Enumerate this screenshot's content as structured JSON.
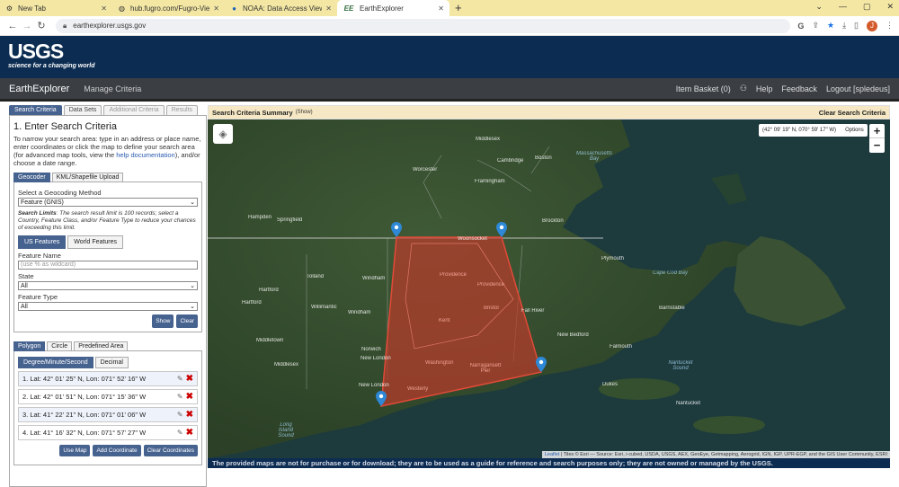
{
  "browser": {
    "tabs": [
      {
        "title": "New Tab",
        "icon": "new-tab-icon"
      },
      {
        "title": "hub.fugro.com/Fugro-Viewer/",
        "icon": "globe-icon"
      },
      {
        "title": "NOAA: Data Access Viewer",
        "icon": "noaa-icon"
      },
      {
        "title": "EarthExplorer",
        "icon": "ee-icon",
        "favicon_text": "EE",
        "active": true
      }
    ],
    "url": "earthexplorer.usgs.gov",
    "profile_initial": "J"
  },
  "usgs": {
    "logo": "USGS",
    "tagline": "science for a changing world"
  },
  "appnav": {
    "brand": "EarthExplorer",
    "manage": "Manage Criteria",
    "item_basket": "Item Basket (0)",
    "help": "Help",
    "feedback": "Feedback",
    "logout": "Logout [spledeus]"
  },
  "left": {
    "tabs": [
      "Search Criteria",
      "Data Sets",
      "Additional Criteria",
      "Results"
    ],
    "heading": "1. Enter Search Criteria",
    "desc_pre": "To narrow your search area: type in an address or place name, enter coordinates or click the map to define your search area (for advanced map tools, view the ",
    "desc_link": "help documentation",
    "desc_post": "), and/or choose a date range.",
    "geo_tabs": [
      "Geocoder",
      "KML/Shapefile Upload"
    ],
    "geocoding_label": "Select a Geocoding Method",
    "geocoding_value": "Feature (GNIS)",
    "limits_bold": "Search Limits",
    "limits_text": ": The search result limit is 100 records; select a Country, Feature Class, and/or Feature Type to reduce your chances of exceeding this limit.",
    "feature_tabs": [
      "US Features",
      "World Features"
    ],
    "feature_name_label": "Feature Name",
    "feature_name_placeholder": "(use % as wildcard)",
    "state_label": "State",
    "state_value": "All",
    "feature_type_label": "Feature Type",
    "feature_type_value": "All",
    "show_btn": "Show",
    "clear_btn": "Clear",
    "area_tabs": [
      "Polygon",
      "Circle",
      "Predefined Area"
    ],
    "format_tabs": [
      "Degree/Minute/Second",
      "Decimal"
    ],
    "coords": [
      "1.  Lat: 42° 01' 25\" N, Lon: 071° 52' 16\" W",
      "2.  Lat: 42° 01' 51\" N, Lon: 071° 15' 36\" W",
      "3.  Lat: 41° 22' 21\" N, Lon: 071° 01' 06\" W",
      "4.  Lat: 41° 16' 32\" N, Lon: 071° 57' 27\" W"
    ],
    "use_map": "Use Map",
    "add_coordinate": "Add Coordinate",
    "clear_coordinates": "Clear Coordinates"
  },
  "map": {
    "summary_title": "Search Criteria Summary",
    "summary_show": "(Show)",
    "clear_criteria": "Clear Search Criteria",
    "cursor_coords": "(42° 09' 19\" N, 070° 59' 17\" W)",
    "options": "Options",
    "zoom_in": "+",
    "zoom_out": "−",
    "attribution_link": "Leaflet",
    "attribution": " | Tiles © Esri — Source: Esri, i-cubed, USDA, USGS, AEX, GeoEye, Getmapping, Aerogrid, IGN, IGP, UPR-EGP, and the GIS User Community, ESRI",
    "polygon_color": "#c0392b",
    "labels": {
      "middlesex": "Middlesex",
      "massachusetts_bay": "Massachusetts Bay",
      "cambridge": "Cambridge",
      "boston": "Boston",
      "worcester": "Worcester",
      "framingham": "Framingham",
      "brockton": "Brockton",
      "hampden": "Hampden",
      "springfield": "Springfield",
      "woonsocket": "Woonsocket",
      "plymouth": "Plymouth",
      "cape_cod_bay": "Cape Cod Bay",
      "tolland": "Tolland",
      "windham": "Windham",
      "providence_county": "Providence",
      "providence_city": "Providence",
      "hartford": "Hartford",
      "hartford_city": "Hartford",
      "barnstable": "Barnstable",
      "willimantic": "Willimantic",
      "windham2": "Windham",
      "bristol": "Bristol",
      "fall_river": "Fall River",
      "middletown": "Middletown",
      "new_bedford": "New Bedford",
      "kent": "Kent",
      "falmouth": "Falmouth",
      "norwich": "Norwich",
      "middlesex2": "Middlesex",
      "new_london": "New London",
      "washington": "Washington",
      "narragansett": "Narragansett Pier",
      "nantucket_sound": "Nantucket Sound",
      "dukes": "Dukes",
      "new_london2": "New London",
      "westerly": "Westerly",
      "nantucket": "Nantucket",
      "long_island_sound": "Long Island Sound"
    },
    "disclaimer": "The provided maps are not for purchase or for download; they are to be used as a guide for reference and search purposes only; they are not owned or managed by the USGS."
  }
}
